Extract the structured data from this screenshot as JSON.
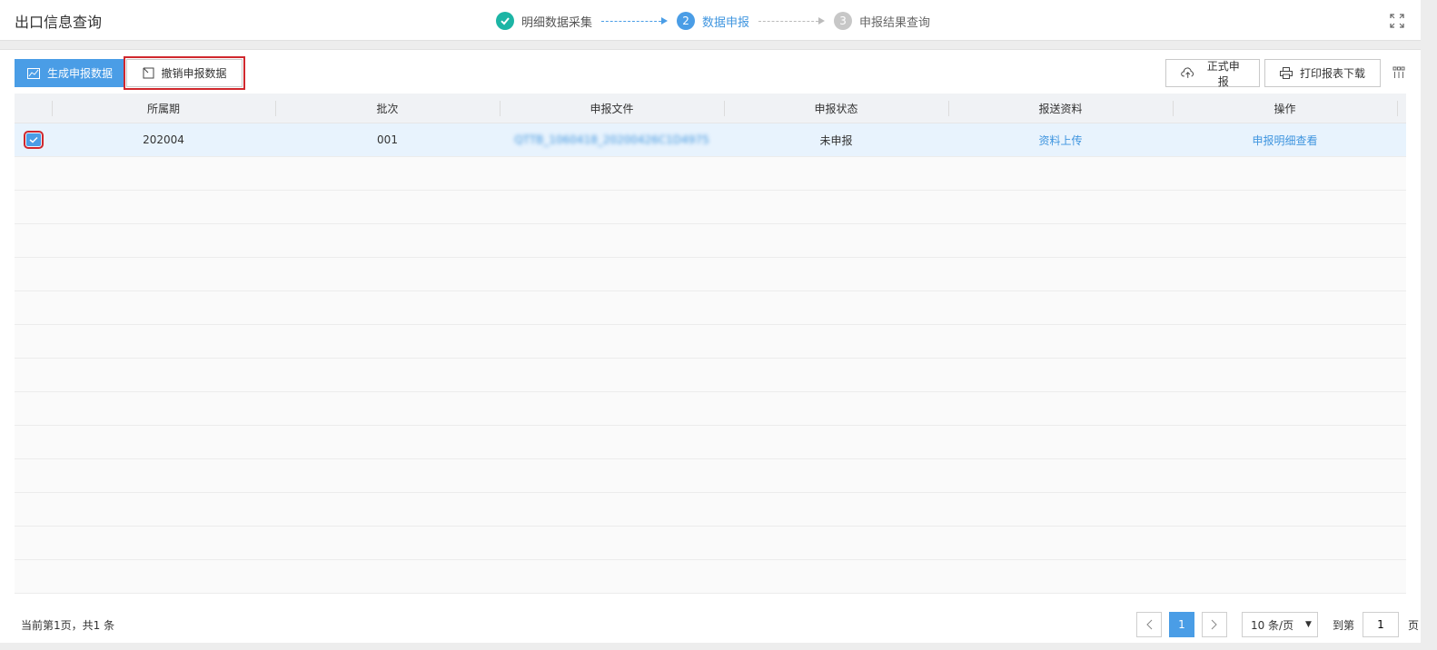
{
  "header": {
    "title": "出口信息查询",
    "steps": [
      {
        "num": "✔",
        "label": "明细数据采集"
      },
      {
        "num": "2",
        "label": "数据申报"
      },
      {
        "num": "3",
        "label": "申报结果查询"
      }
    ],
    "fullscreen_icon": "fullscreen-icon"
  },
  "toolbar": {
    "generate_label": "生成申报数据",
    "revoke_label": "撤销申报数据",
    "formal_label": "正式申报",
    "print_label": "打印报表下载"
  },
  "table": {
    "columns": [
      "所属期",
      "批次",
      "申报文件",
      "申报状态",
      "报送资料",
      "操作"
    ],
    "rows": [
      {
        "checked": true,
        "period": "202004",
        "batch": "001",
        "file": "QTTB_1060418_20200426C1D4975",
        "status": "未申报",
        "upload": "资料上传",
        "action": "申报明细查看"
      }
    ],
    "empty_rows": 13
  },
  "pagination": {
    "info": "当前第1页，共1 条",
    "current_page": "1",
    "page_size": "10 条/页",
    "goto_label": "到第",
    "goto_value": "1",
    "page_suffix": "页"
  },
  "colors": {
    "primary": "#4a9de6",
    "success": "#1cb5a5",
    "highlight": "#d0282e"
  }
}
